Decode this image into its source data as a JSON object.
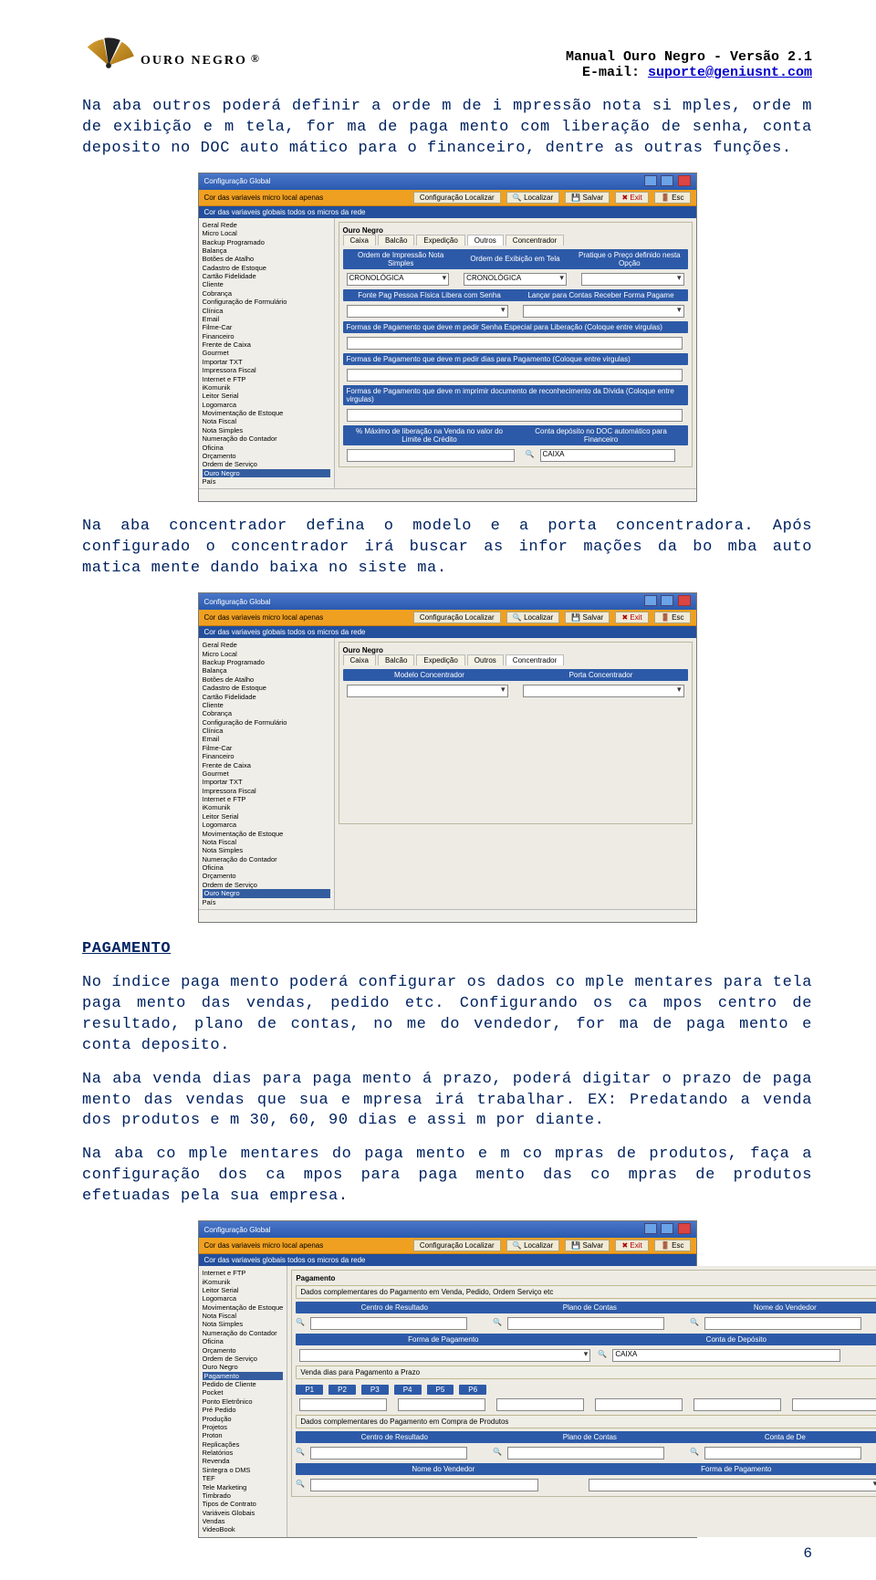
{
  "header": {
    "logo_brand": "OURO NEGRO",
    "title_line1": "Manual Ouro Negro - Versão 2.1",
    "email_label": "E-mail: ",
    "email": "suporte@geniusnt.com"
  },
  "para1": "Na aba outros poderá definir a orde m de i mpressão nota si mples, orde m de exibição e m tela, for ma de paga mento com liberação de senha, conta deposito no DOC auto mático para o financeiro, dentre as outras funções.",
  "para2": "Na aba concentrador defina o modelo e a porta concentradora. Após configurado o concentrador irá buscar as infor mações da bo mba auto matica mente dando baixa no siste ma.",
  "heading_pagamento": "PAGAMENTO",
  "para3": "No índice paga mento poderá configurar os dados co mple mentares para tela paga mento das vendas, pedido etc. Configurando os ca mpos centro de resultado, plano de contas, no me do vendedor, for ma de paga mento e conta deposito.",
  "para4": "Na aba venda dias para paga mento á prazo, poderá digitar o prazo de paga mento das vendas que sua e mpresa irá trabalhar. EX: Predatando a venda dos produtos e m 30, 60, 90 dias e assi m por diante.",
  "para5": "Na aba co mple mentares do paga mento e m co mpras de produtos, faça a configuração dos ca mpos para paga mento das co mpras de produtos efetuadas pela sua empresa.",
  "page_number": "6",
  "screenshot_common": {
    "window_title": "Configuração Global",
    "bar1_label": "Cor das variaveis micro local apenas",
    "bar1_button": "Configuração Localizar",
    "tool_localizar": "Localizar",
    "tool_salvar": "Salvar",
    "tool_exit": "Exit",
    "tool_esc": "Esc",
    "bar2_label": "Cor das variaveis globais todos os micros da rede",
    "tabgroup_label": "Ouro Negro"
  },
  "ss1": {
    "sidebar": [
      "Geral Rede",
      "Micro Local",
      "Backup Programado",
      "Balança",
      "Botões de Atalho",
      "Cadastro de Estoque",
      "Cartão Fidelidade",
      "Cliente",
      "Cobrança",
      "Configuração de Formulário",
      "Clínica",
      "Email",
      "Filme-Car",
      "Financeiro",
      "Frente de Caixa",
      "Gourmet",
      "Importar TXT",
      "Impressora Fiscal",
      "Internet e FTP",
      "iKomunik",
      "Leitor Serial",
      "Logomarca",
      "Movimentação de Estoque",
      "Nota Fiscal",
      "Nota Simples",
      "Numeração do Contador",
      "Oficina",
      "Orçamento",
      "Ordem de Serviço",
      "Ouro Negro",
      "País"
    ],
    "highlight": "Ouro Negro",
    "tabs": [
      "Caixa",
      "Balcão",
      "Expedição",
      "Outros",
      "Concentrador"
    ],
    "active_tab": "Outros",
    "row_a_left": "Ordem de Impressão Nota Simples",
    "row_a_right": "Ordem de Exibição em Tela",
    "row_a_extra": "Pratique o Preço definido nesta Opção",
    "dd_value": "CRONOLÓGICA",
    "row_b_left": "Fonte Pag Pessoa Física Libera com Senha",
    "row_b_right": "Lançar para Contas Receber Forma Pagame",
    "row_c": "Formas de Pagamento que deve m pedir Senha Especial para Liberação (Coloque entre virgulas)",
    "row_d": "Formas de Pagamento que deve m pedir dias para Pagamento (Coloque entre virgulas)",
    "row_e": "Formas de Pagamento que deve m imprimir documento de reconhecimento da Dívida (Coloque entre virgulas)",
    "row_f_left": "% Máximo de liberação na Venda no valor do Limite de Crédito",
    "row_f_right": "Conta depósito no DOC automático para Financeiro",
    "caixa_label": "CAIXA"
  },
  "ss2": {
    "sidebar": [
      "Geral Rede",
      "Micro Local",
      "Backup Programado",
      "Balança",
      "Botões de Atalho",
      "Cadastro de Estoque",
      "Cartão Fidelidade",
      "Cliente",
      "Cobrança",
      "Configuração de Formulário",
      "Clínica",
      "Email",
      "Filme-Car",
      "Financeiro",
      "Frente de Caixa",
      "Gourmet",
      "Importar TXT",
      "Impressora Fiscal",
      "Internet e FTP",
      "iKomunik",
      "Leitor Serial",
      "Logomarca",
      "Movimentação de Estoque",
      "Nota Fiscal",
      "Nota Simples",
      "Numeração do Contador",
      "Oficina",
      "Orçamento",
      "Ordem de Serviço",
      "Ouro Negro",
      "País"
    ],
    "highlight": "Ouro Negro",
    "tabs": [
      "Caixa",
      "Balcão",
      "Expedição",
      "Outros",
      "Concentrador"
    ],
    "active_tab": "Concentrador",
    "field_left": "Modelo Concentrador",
    "field_right": "Porta Concentrador"
  },
  "ss3": {
    "sidebar": [
      "Internet e FTP",
      "iKomunik",
      "Leitor Serial",
      "Logomarca",
      "Movimentação de Estoque",
      "Nota Fiscal",
      "Nota Simples",
      "Numeração do Contador",
      "Oficina",
      "Orçamento",
      "Ordem de Serviço",
      "Ouro Negro",
      "Pagamento",
      "Pedido de Cliente",
      "Pocket",
      "Ponto Eletrônico",
      "Pré Pedido",
      "Produção",
      "Projetos",
      "Proton",
      "Replicações",
      "Relatórios",
      "Revenda",
      "Sintegra o DMS",
      "TEF",
      "Tele Marketing",
      "Timbrado",
      "Tipos de Contrato",
      "Variáveis Globais",
      "Vendas",
      "VideoBook"
    ],
    "highlight": "Pagamento",
    "tabgroup_label": "Pagamento",
    "sec1_title": "Dados complementares do Pagamento em Venda, Pedido, Ordem Serviço etc",
    "f_centro": "Centro de Resultado",
    "f_plano": "Plano de Contas",
    "f_nomevend": "Nome do Vendedor",
    "f_forma": "Forma de Pagamento",
    "f_conta": "Conta de Depósito",
    "caixa_value": "CAIXA",
    "sec2_title": "Venda dias para Pagamento a Prazo",
    "pills": [
      "P1",
      "P2",
      "P3",
      "P4",
      "P5",
      "P6"
    ],
    "sec3_title": "Dados complementares do Pagamento em Compra de Produtos",
    "g_centro": "Centro de Resultado",
    "g_plano": "Plano de Contas",
    "g_conta": "Conta de De",
    "g_nomevend": "Nome do Vendedor",
    "g_forma": "Forma de Pagamento"
  }
}
